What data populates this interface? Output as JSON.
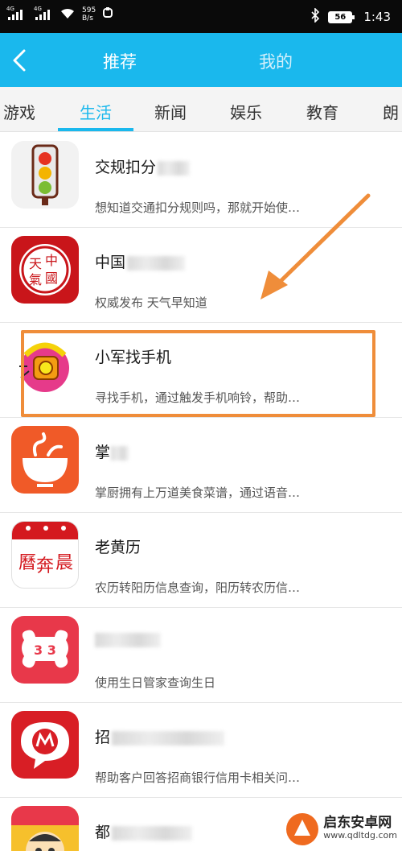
{
  "status_bar": {
    "network1": "4G",
    "network2": "4G",
    "speed": "595",
    "speed_unit": "B/s",
    "battery": "56",
    "time": "1:43"
  },
  "header": {
    "tabs": [
      {
        "label": "推荐",
        "active": true
      },
      {
        "label": "我的",
        "active": false
      }
    ],
    "background": "#1ab8ed"
  },
  "category_tabs": [
    {
      "label": "游戏",
      "active": false
    },
    {
      "label": "生活",
      "active": true
    },
    {
      "label": "新闻",
      "active": false
    },
    {
      "label": "娱乐",
      "active": false
    },
    {
      "label": "教育",
      "active": false
    },
    {
      "label": "朗",
      "active": false
    }
  ],
  "apps": [
    {
      "title": "交规扣分",
      "description": "想知道交通扣分规则吗，那就开始使…",
      "icon": "traffic-light-icon"
    },
    {
      "title": "中国",
      "description": "权威发布 天气早知道",
      "icon": "china-seal-icon"
    },
    {
      "title": "小军找手机",
      "description": "寻找手机，通过触发手机响铃，帮助…",
      "icon": "phone-finder-icon"
    },
    {
      "title": "掌",
      "description": "掌厨拥有上万道美食菜谱，通过语音…",
      "icon": "bowl-icon"
    },
    {
      "title": "老黄历",
      "description": "农历转阳历信息查询，阳历转农历信…",
      "icon": "calendar-icon"
    },
    {
      "title": "",
      "description": "使用生日管家查询生日",
      "icon": "birthday-bone-icon"
    },
    {
      "title": "招",
      "description": "帮助客户回答招商银行信用卡相关问…",
      "icon": "cmb-bank-icon"
    },
    {
      "title": "都",
      "description": "",
      "icon": "cartoon-face-icon"
    }
  ],
  "watermark": {
    "name": "启东安卓网",
    "url": "www.qdltdg.com"
  },
  "colors": {
    "accent": "#1ab8ed",
    "annotation": "#ef8d3a"
  }
}
